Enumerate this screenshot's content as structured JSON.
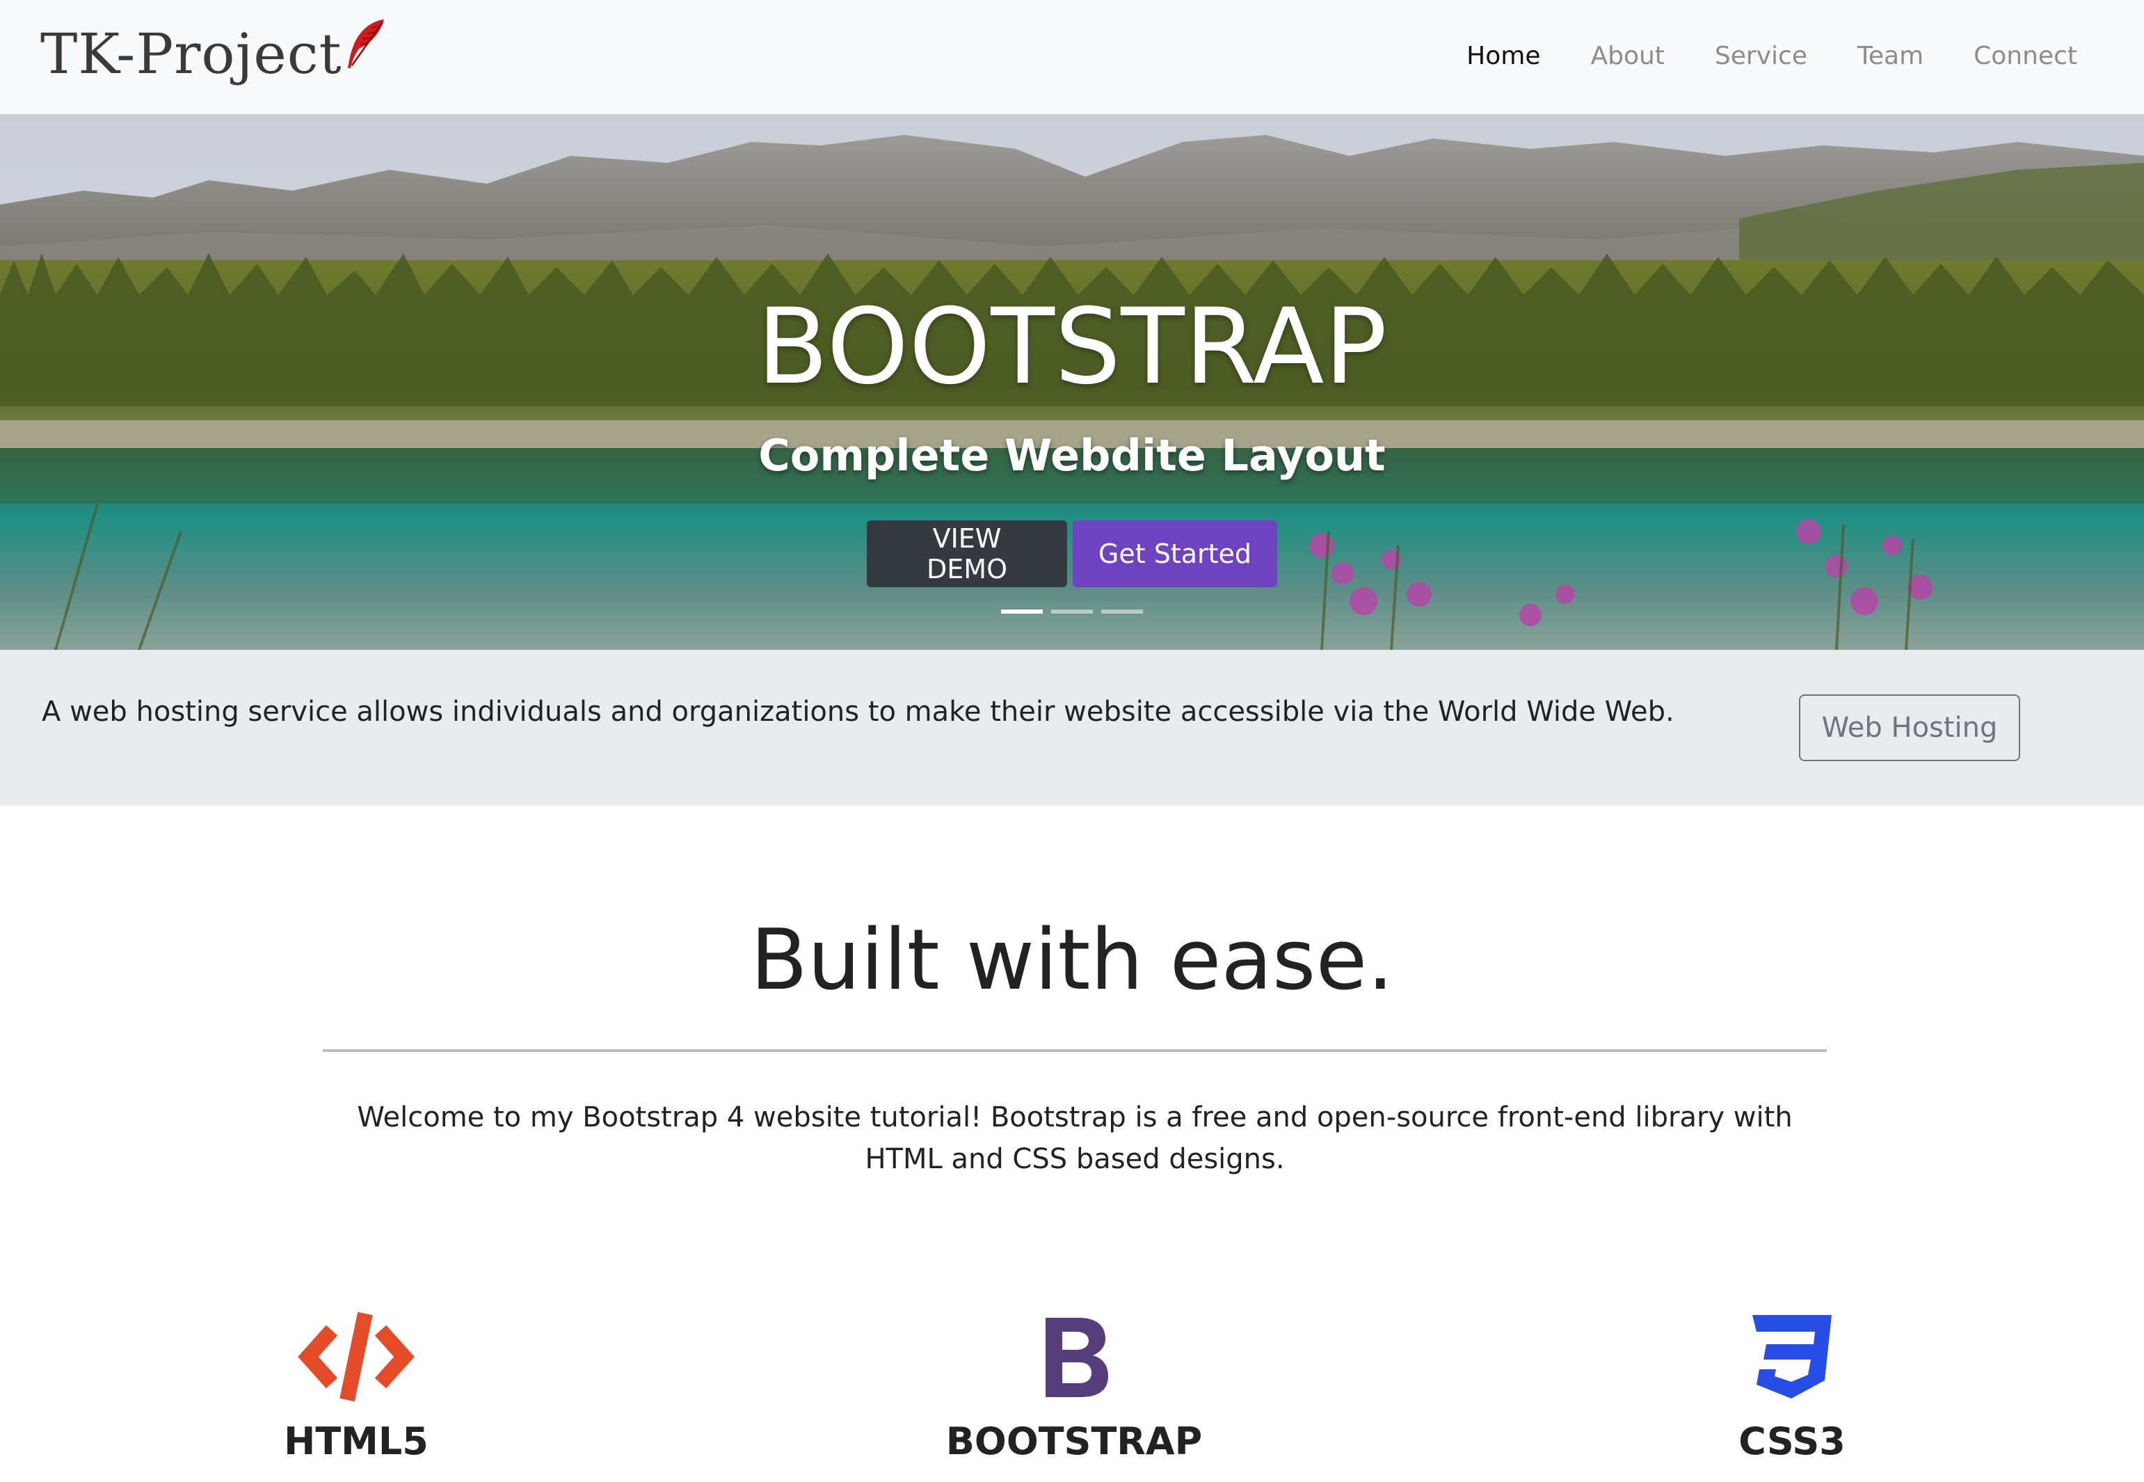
{
  "navbar": {
    "brand": "TK-Project",
    "links": [
      {
        "label": "Home",
        "active": true
      },
      {
        "label": "About",
        "active": false
      },
      {
        "label": "Service",
        "active": false
      },
      {
        "label": "Team",
        "active": false
      },
      {
        "label": "Connect",
        "active": false
      }
    ]
  },
  "hero": {
    "title": "BOOTSTRAP",
    "subtitle": "Complete Webdite Layout",
    "buttons": {
      "demo": "VIEW DEMO",
      "start": "Get Started"
    },
    "slides_count": 3,
    "active_slide": 1
  },
  "band": {
    "text": "A web hosting service allows individuals and organizations to make their website accessible via the World Wide Web.",
    "button": "Web Hosting"
  },
  "welcome": {
    "heading": "Built with ease.",
    "text": "Welcome to my Bootstrap 4 website tutorial! Bootstrap is a free and open-source front-end library with HTML and CSS based designs."
  },
  "features": [
    {
      "title": "HTML5",
      "icon": "html5-code-icon",
      "color": "#e34c26"
    },
    {
      "title": "BOOTSTRAP",
      "icon": "bootstrap-icon",
      "color": "#563d7c"
    },
    {
      "title": "CSS3",
      "icon": "css3-icon",
      "color": "#264de4"
    }
  ],
  "colors": {
    "navbar_bg": "#f8f9fa",
    "band_bg": "#e9ecef",
    "btn_dark": "#343a40",
    "btn_purple": "#6f42c1",
    "outline": "#6c757d",
    "quill": "#d11a1a"
  }
}
